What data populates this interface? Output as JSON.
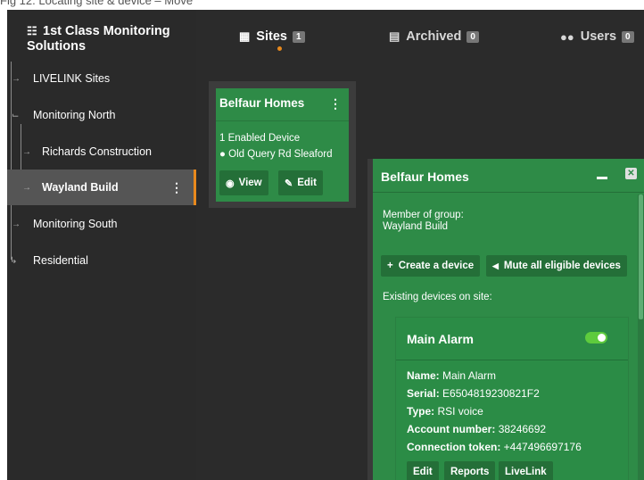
{
  "caption": "Fig 12. Locating site & device – Move",
  "colors": {
    "accent": "#e8891d",
    "green": "#2e8b47",
    "dark_bg": "#2b2b2b"
  },
  "sidebar": {
    "org_name": "1st Class Monitoring Solutions",
    "org_icon": "org-tree-icon",
    "items": [
      {
        "label": "LIVELINK Sites"
      },
      {
        "label": "Monitoring North"
      },
      {
        "label": "Richards Construction"
      },
      {
        "label": "Wayland Build",
        "active": true
      },
      {
        "label": "Monitoring South"
      },
      {
        "label": "Residential"
      }
    ]
  },
  "tabs": [
    {
      "label": "Sites",
      "count": "1",
      "icon": "building-icon",
      "active": true
    },
    {
      "label": "Archived",
      "count": "0",
      "icon": "archive-icon"
    },
    {
      "label": "Users",
      "count": "0",
      "icon": "users-icon"
    }
  ],
  "site_card": {
    "title": "Belfaur Homes",
    "devices": "1 Enabled Device",
    "address": "Old Query Rd Sleaford",
    "view_label": "View",
    "edit_label": "Edit"
  },
  "panel": {
    "title": "Belfaur Homes",
    "member_label": "Member of group:",
    "member_value": "Wayland Build",
    "create_device": "Create a device",
    "mute_all": "Mute all eligible devices",
    "existing_label": "Existing devices on site:",
    "device": {
      "name": "Main Alarm",
      "enabled": true,
      "fields": {
        "name_label": "Name:",
        "name_value": "Main Alarm",
        "serial_label": "Serial:",
        "serial_value": "E6504819230821F2",
        "type_label": "Type:",
        "type_value": "RSI voice",
        "account_label": "Account number:",
        "account_value": "38246692",
        "token_label": "Connection token:",
        "token_value": "+447496697176"
      },
      "buttons": {
        "edit": "Edit",
        "reports": "Reports",
        "livelink": "LiveLink"
      }
    }
  }
}
